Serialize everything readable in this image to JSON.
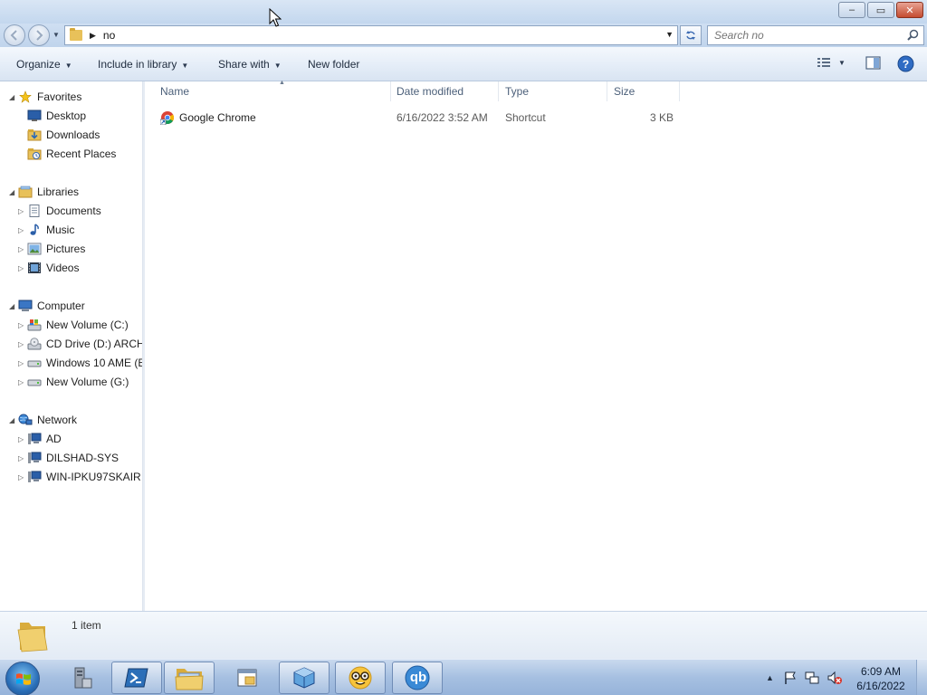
{
  "window": {
    "address_path": "no",
    "search_placeholder": "Search no",
    "caption": {
      "minimize": "–",
      "maximize": "▭",
      "close": "✕"
    }
  },
  "toolbar": {
    "organize": "Organize",
    "include_in_library": "Include in library",
    "share_with": "Share with",
    "new_folder": "New folder"
  },
  "sidebar": {
    "favorites": {
      "label": "Favorites",
      "items": [
        {
          "label": "Desktop",
          "icon": "desktop-icon"
        },
        {
          "label": "Downloads",
          "icon": "downloads-folder-icon"
        },
        {
          "label": "Recent Places",
          "icon": "recent-places-icon"
        }
      ]
    },
    "libraries": {
      "label": "Libraries",
      "items": [
        {
          "label": "Documents",
          "icon": "documents-icon"
        },
        {
          "label": "Music",
          "icon": "music-icon"
        },
        {
          "label": "Pictures",
          "icon": "pictures-icon"
        },
        {
          "label": "Videos",
          "icon": "videos-icon"
        }
      ]
    },
    "computer": {
      "label": "Computer",
      "items": [
        {
          "label": "New Volume (C:)",
          "icon": "system-drive-icon"
        },
        {
          "label": "CD Drive (D:) ARCH_",
          "icon": "cd-drive-icon"
        },
        {
          "label": "Windows 10 AME (E:",
          "icon": "hard-drive-icon"
        },
        {
          "label": "New Volume (G:)",
          "icon": "hard-drive-icon"
        }
      ]
    },
    "network": {
      "label": "Network",
      "items": [
        {
          "label": "AD",
          "icon": "network-computer-icon"
        },
        {
          "label": "DILSHAD-SYS",
          "icon": "network-computer-icon"
        },
        {
          "label": "WIN-IPKU97SKAIR",
          "icon": "network-computer-icon"
        }
      ]
    }
  },
  "file_list": {
    "columns": [
      "Name",
      "Date modified",
      "Type",
      "Size"
    ],
    "rows": [
      {
        "name": "Google Chrome",
        "date_modified": "6/16/2022 3:52 AM",
        "type": "Shortcut",
        "size": "3 KB",
        "icon": "chrome-shortcut-icon"
      }
    ]
  },
  "details_pane": {
    "item_count": "1 item"
  },
  "taskbar": {
    "pinned": [
      "server-manager-icon",
      "powershell-icon",
      "file-explorer-icon",
      "folder-window-icon",
      "virtualbox-icon",
      "nerd-emoji-app-icon",
      "qbittorrent-icon"
    ],
    "qbittorrent_label": "qb",
    "clock_time": "6:09 AM",
    "clock_date": "6/16/2022"
  },
  "colors": {
    "accent": "#3b6ab2",
    "close_button": "#c44c30",
    "folder": "#e8c15a"
  }
}
